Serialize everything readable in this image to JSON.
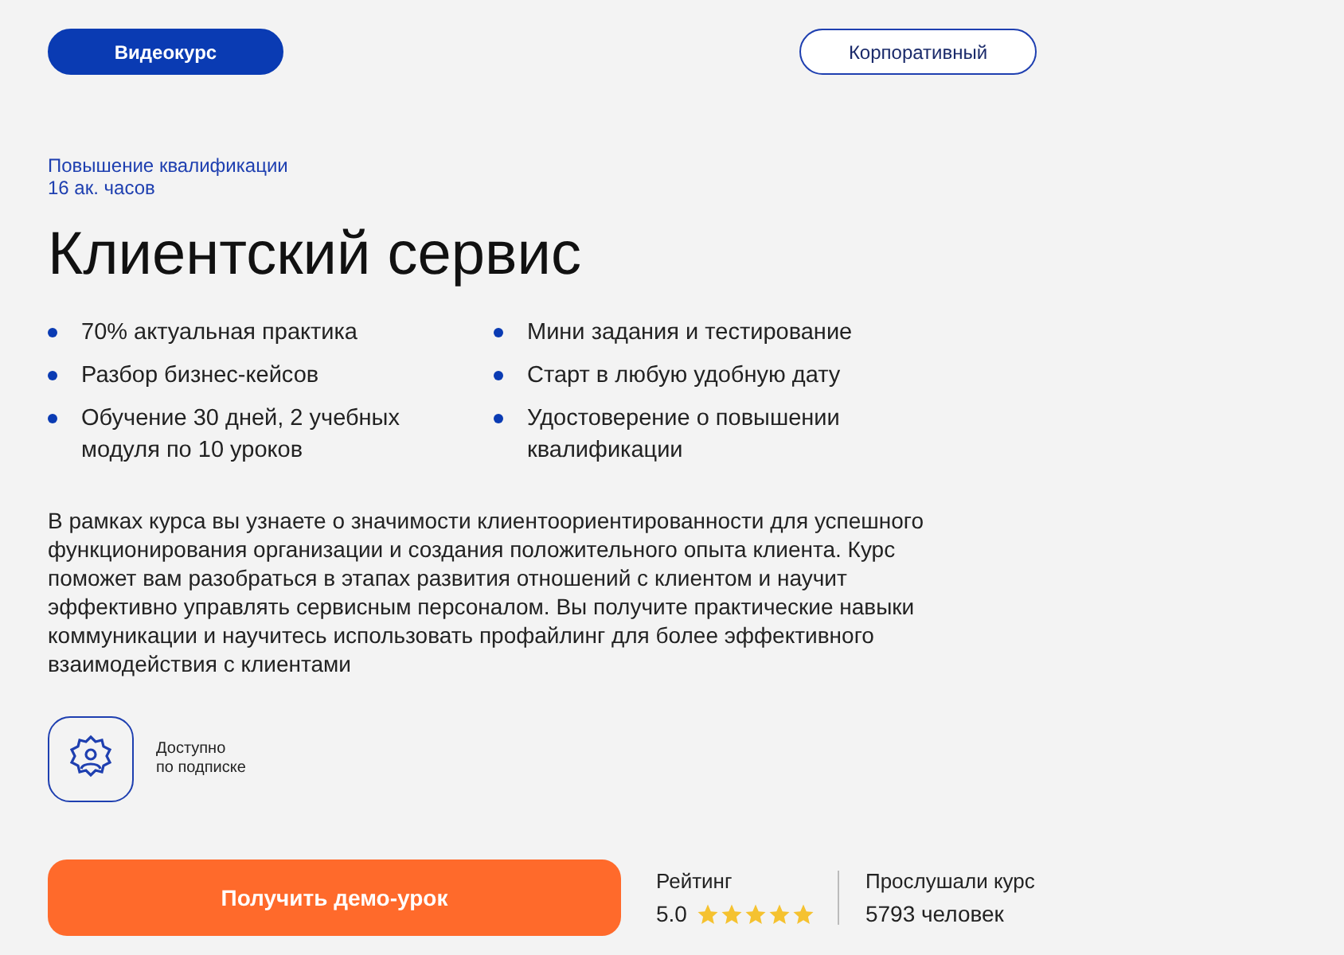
{
  "tabs": [
    {
      "label": "Видеокурс",
      "selected": true
    },
    {
      "label": "Корпоративный",
      "selected": false
    }
  ],
  "category": "Повышение квалификации",
  "hours": "16 ак. часов",
  "title": "Клиентский сервис",
  "features": [
    [
      "70% актуальная практика",
      "Разбор бизнес-кейсов",
      "Обучение 30 дней, 2 учебных модуля по 10 уроков"
    ],
    [
      "Мини задания и тестирование",
      "Старт в любую удобную дату",
      "Удостоверение о повышении квалификации"
    ]
  ],
  "description": "В рамках курса вы узнаете о значимости клиентоориентированности для успешного функционирования организации и создания положительного опыта клиента. Курс поможет вам разобраться в этапах развития отношений с клиентом и научит эффективно управлять сервисным персоналом. Вы получите практические навыки коммуникации и научитесь использовать профайлинг для более эффективного взаимодействия с клиентами",
  "subscription": [
    "Доступно",
    "по подписке"
  ],
  "cta": "Получить демо-урок",
  "rating": {
    "label": "Рейтинг",
    "value": "5.0",
    "stars": 5
  },
  "listeners": {
    "label": "Прослушали курс",
    "value": "5793 человек"
  }
}
